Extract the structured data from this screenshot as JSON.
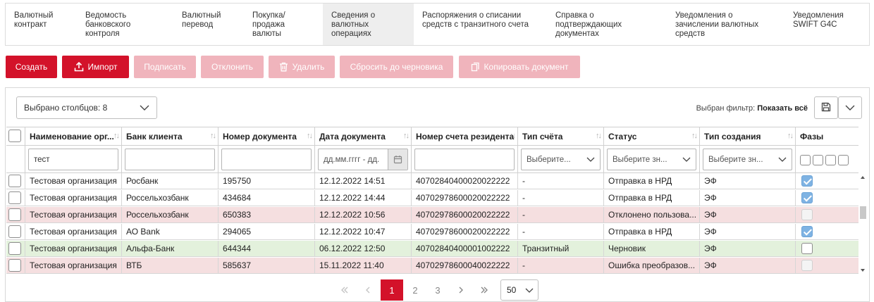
{
  "tabs": [
    {
      "label": "Валютный\nконтракт",
      "active": false
    },
    {
      "label": "Ведомость\nбанковского\nконтроля",
      "active": false
    },
    {
      "label": "Валютный\nперевод",
      "active": false
    },
    {
      "label": "Покупка/\nпродажа\nвалюты",
      "active": false
    },
    {
      "label": "Сведения о\nвалютных\nоперациях",
      "active": true
    },
    {
      "label": "Распоряжения о списании\nсредств с транзитного счета",
      "active": false
    },
    {
      "label": "Справка о\nподтверждающих\nдокументах",
      "active": false
    },
    {
      "label": "Уведомления о\nзачислении валютных\nсредств",
      "active": false
    },
    {
      "label": "Уведомления\nSWIFT G4C",
      "active": false
    }
  ],
  "toolbar": {
    "create": "Создать",
    "import": "Импорт",
    "sign": "Подписать",
    "reject": "Отклонить",
    "delete": "Удалить",
    "reset_draft": "Сбросить до черновика",
    "copy": "Копировать документ"
  },
  "panel": {
    "columns_selected": "Выбрано столбцов: 8",
    "filter_label": "Выбран фильтр:",
    "filter_value": "Показать всё"
  },
  "columns": [
    "Наименование орг...",
    "Банк клиента",
    "Номер документа",
    "Дата документа",
    "Номер счета резидента",
    "Тип счёта",
    "Статус",
    "Тип создания",
    "Фазы"
  ],
  "filters": {
    "org": "тест",
    "bank": "",
    "doc_number": "",
    "date_placeholder": "дд.мм.гггг - дд.",
    "account": "",
    "account_type_placeholder": "Выберите...",
    "status_placeholder": "Выберите зн...",
    "creation_type_placeholder": "Выберите зн..."
  },
  "rows": [
    {
      "org": "Тестовая организация",
      "bank": "Росбанк",
      "num": "195750",
      "date": "12.12.2022 14:51",
      "account": "40702840400020022222",
      "type": "-",
      "status": "Отправка в НРД",
      "creation": "ЭФ",
      "phase": "checked",
      "tone": "white"
    },
    {
      "org": "Тестовая организация",
      "bank": "Россельхозбанк",
      "num": "434684",
      "date": "12.12.2022 14:44",
      "account": "40702978600020022222",
      "type": "-",
      "status": "Отправка в НРД",
      "creation": "ЭФ",
      "phase": "checked",
      "tone": "white"
    },
    {
      "org": "Тестовая организация",
      "bank": "Россельхозбанк",
      "num": "650383",
      "date": "12.12.2022 10:56",
      "account": "40702978600020022222",
      "type": "-",
      "status": "Отклонено пользова...",
      "creation": "ЭФ",
      "phase": "disabled",
      "tone": "red"
    },
    {
      "org": "Тестовая организация",
      "bank": "АО Bank",
      "num": "294065",
      "date": "12.12.2022 10:47",
      "account": "40702978600020022222",
      "type": "-",
      "status": "Отправка в НРД",
      "creation": "ЭФ",
      "phase": "checked",
      "tone": "white"
    },
    {
      "org": "Тестовая организация",
      "bank": "Альфа-Банк",
      "num": "644344",
      "date": "06.12.2022 12:50",
      "account": "40702840400001002222",
      "type": "Транзитный",
      "status": "Черновик",
      "creation": "ЭФ",
      "phase": "empty",
      "tone": "green"
    },
    {
      "org": "Тестовая организация",
      "bank": "ВТБ",
      "num": "585637",
      "date": "15.11.2022 11:40",
      "account": "40702978600040022222",
      "type": "-",
      "status": "Ошибка преобразов...",
      "creation": "ЭФ",
      "phase": "disabled",
      "tone": "red"
    }
  ],
  "pagination": {
    "pages": [
      "1",
      "2",
      "3"
    ],
    "current": "1",
    "page_size": "50"
  },
  "colors": {
    "accent": "#d3122a",
    "accent_disabled": "#f0b4bc",
    "row_red": "#f5dfe0",
    "row_green": "#e3f1dc",
    "checkbox_checked": "#7fb3e3"
  }
}
